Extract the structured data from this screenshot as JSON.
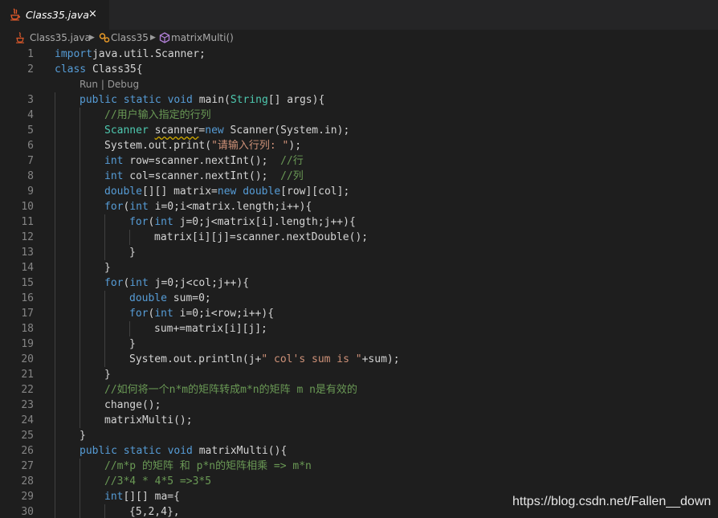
{
  "tab": {
    "title": "Class35.java",
    "close_glyph": "×",
    "icon": "java-icon"
  },
  "breadcrumb": [
    {
      "label": "Class35.java",
      "icon": "java-file-icon"
    },
    {
      "label": "Class35",
      "icon": "class-icon"
    },
    {
      "label": "matrixMulti()",
      "icon": "method-icon"
    }
  ],
  "codelens": {
    "run": "Run",
    "separator": " | ",
    "debug": "Debug"
  },
  "lines": [
    {
      "num": "1",
      "indent": 0,
      "tokens": [
        [
          "kw",
          "import"
        ],
        [
          "",
          "java.util.Scanner;"
        ]
      ]
    },
    {
      "num": "2",
      "indent": 0,
      "tokens": [
        [
          "kw",
          "class"
        ],
        [
          "",
          " Class35{"
        ]
      ]
    },
    {
      "num": "3",
      "indent": 1,
      "tokens": [
        [
          "kw",
          "public static void"
        ],
        [
          "",
          " main("
        ],
        [
          "ty",
          "String"
        ],
        [
          "",
          "[] args){"
        ]
      ]
    },
    {
      "num": "4",
      "indent": 2,
      "tokens": [
        [
          "cm",
          "//用户输入指定的行列"
        ]
      ]
    },
    {
      "num": "5",
      "indent": 2,
      "tokens": [
        [
          "ty",
          "Scanner"
        ],
        [
          "",
          " "
        ],
        [
          "sq",
          "scanner"
        ],
        [
          "",
          "="
        ],
        [
          "kw",
          "new"
        ],
        [
          "",
          " Scanner(System.in);"
        ]
      ]
    },
    {
      "num": "6",
      "indent": 2,
      "tokens": [
        [
          "",
          "System.out.print("
        ],
        [
          "str",
          "\"请输入行列: \""
        ],
        [
          "",
          ");"
        ]
      ]
    },
    {
      "num": "7",
      "indent": 2,
      "tokens": [
        [
          "kw",
          "int"
        ],
        [
          "",
          " row=scanner.nextInt();  "
        ],
        [
          "cm",
          "//行"
        ]
      ]
    },
    {
      "num": "8",
      "indent": 2,
      "tokens": [
        [
          "kw",
          "int"
        ],
        [
          "",
          " col=scanner.nextInt();  "
        ],
        [
          "cm",
          "//列"
        ]
      ]
    },
    {
      "num": "9",
      "indent": 2,
      "tokens": [
        [
          "kw",
          "double"
        ],
        [
          "",
          "[][] matrix="
        ],
        [
          "kw",
          "new"
        ],
        [
          "",
          " "
        ],
        [
          "kw",
          "double"
        ],
        [
          "",
          "[row][col];"
        ]
      ]
    },
    {
      "num": "10",
      "indent": 2,
      "tokens": [
        [
          "kw",
          "for"
        ],
        [
          "",
          "("
        ],
        [
          "kw",
          "int"
        ],
        [
          "",
          " i=0;i<matrix.length;i++){"
        ]
      ]
    },
    {
      "num": "11",
      "indent": 3,
      "tokens": [
        [
          "kw",
          "for"
        ],
        [
          "",
          "("
        ],
        [
          "kw",
          "int"
        ],
        [
          "",
          " j=0;j<matrix[i].length;j++){"
        ]
      ]
    },
    {
      "num": "12",
      "indent": 4,
      "tokens": [
        [
          "",
          "matrix[i][j]=scanner.nextDouble();"
        ]
      ]
    },
    {
      "num": "13",
      "indent": 3,
      "tokens": [
        [
          "",
          "}"
        ]
      ]
    },
    {
      "num": "14",
      "indent": 2,
      "tokens": [
        [
          "",
          "}"
        ]
      ]
    },
    {
      "num": "15",
      "indent": 2,
      "tokens": [
        [
          "kw",
          "for"
        ],
        [
          "",
          "("
        ],
        [
          "kw",
          "int"
        ],
        [
          "",
          " j=0;j<col;j++){"
        ]
      ]
    },
    {
      "num": "16",
      "indent": 3,
      "tokens": [
        [
          "kw",
          "double"
        ],
        [
          "",
          " sum=0;"
        ]
      ]
    },
    {
      "num": "17",
      "indent": 3,
      "tokens": [
        [
          "kw",
          "for"
        ],
        [
          "",
          "("
        ],
        [
          "kw",
          "int"
        ],
        [
          "",
          " i=0;i<row;i++){"
        ]
      ]
    },
    {
      "num": "18",
      "indent": 4,
      "tokens": [
        [
          "",
          "sum+=matrix[i][j];"
        ]
      ]
    },
    {
      "num": "19",
      "indent": 3,
      "tokens": [
        [
          "",
          "}"
        ]
      ]
    },
    {
      "num": "20",
      "indent": 3,
      "tokens": [
        [
          "",
          "System.out.println(j+"
        ],
        [
          "str",
          "\" col's sum is \""
        ],
        [
          "",
          "+sum);"
        ]
      ]
    },
    {
      "num": "21",
      "indent": 2,
      "tokens": [
        [
          "",
          "}"
        ]
      ]
    },
    {
      "num": "22",
      "indent": 2,
      "tokens": [
        [
          "cm",
          "//如何将一个n*m的矩阵转成m*n的矩阵 m n是有效的"
        ]
      ]
    },
    {
      "num": "23",
      "indent": 2,
      "tokens": [
        [
          "",
          "change();"
        ]
      ]
    },
    {
      "num": "24",
      "indent": 2,
      "tokens": [
        [
          "",
          "matrixMulti();"
        ]
      ]
    },
    {
      "num": "25",
      "indent": 1,
      "tokens": [
        [
          "",
          "}"
        ]
      ]
    },
    {
      "num": "26",
      "indent": 1,
      "tokens": [
        [
          "kw",
          "public static void"
        ],
        [
          "",
          " matrixMulti(){"
        ]
      ]
    },
    {
      "num": "27",
      "indent": 2,
      "tokens": [
        [
          "cm",
          "//m*p 的矩阵 和 p*n的矩阵相乘 => m*n"
        ]
      ]
    },
    {
      "num": "28",
      "indent": 2,
      "tokens": [
        [
          "cm",
          "//3*4 * 4*5 =>3*5"
        ]
      ]
    },
    {
      "num": "29",
      "indent": 2,
      "tokens": [
        [
          "kw",
          "int"
        ],
        [
          "",
          "[][] ma={"
        ]
      ]
    },
    {
      "num": "30",
      "indent": 3,
      "tokens": [
        [
          "",
          "{5,2,4},"
        ]
      ]
    }
  ],
  "watermark": "https://blog.csdn.net/Fallen__down"
}
